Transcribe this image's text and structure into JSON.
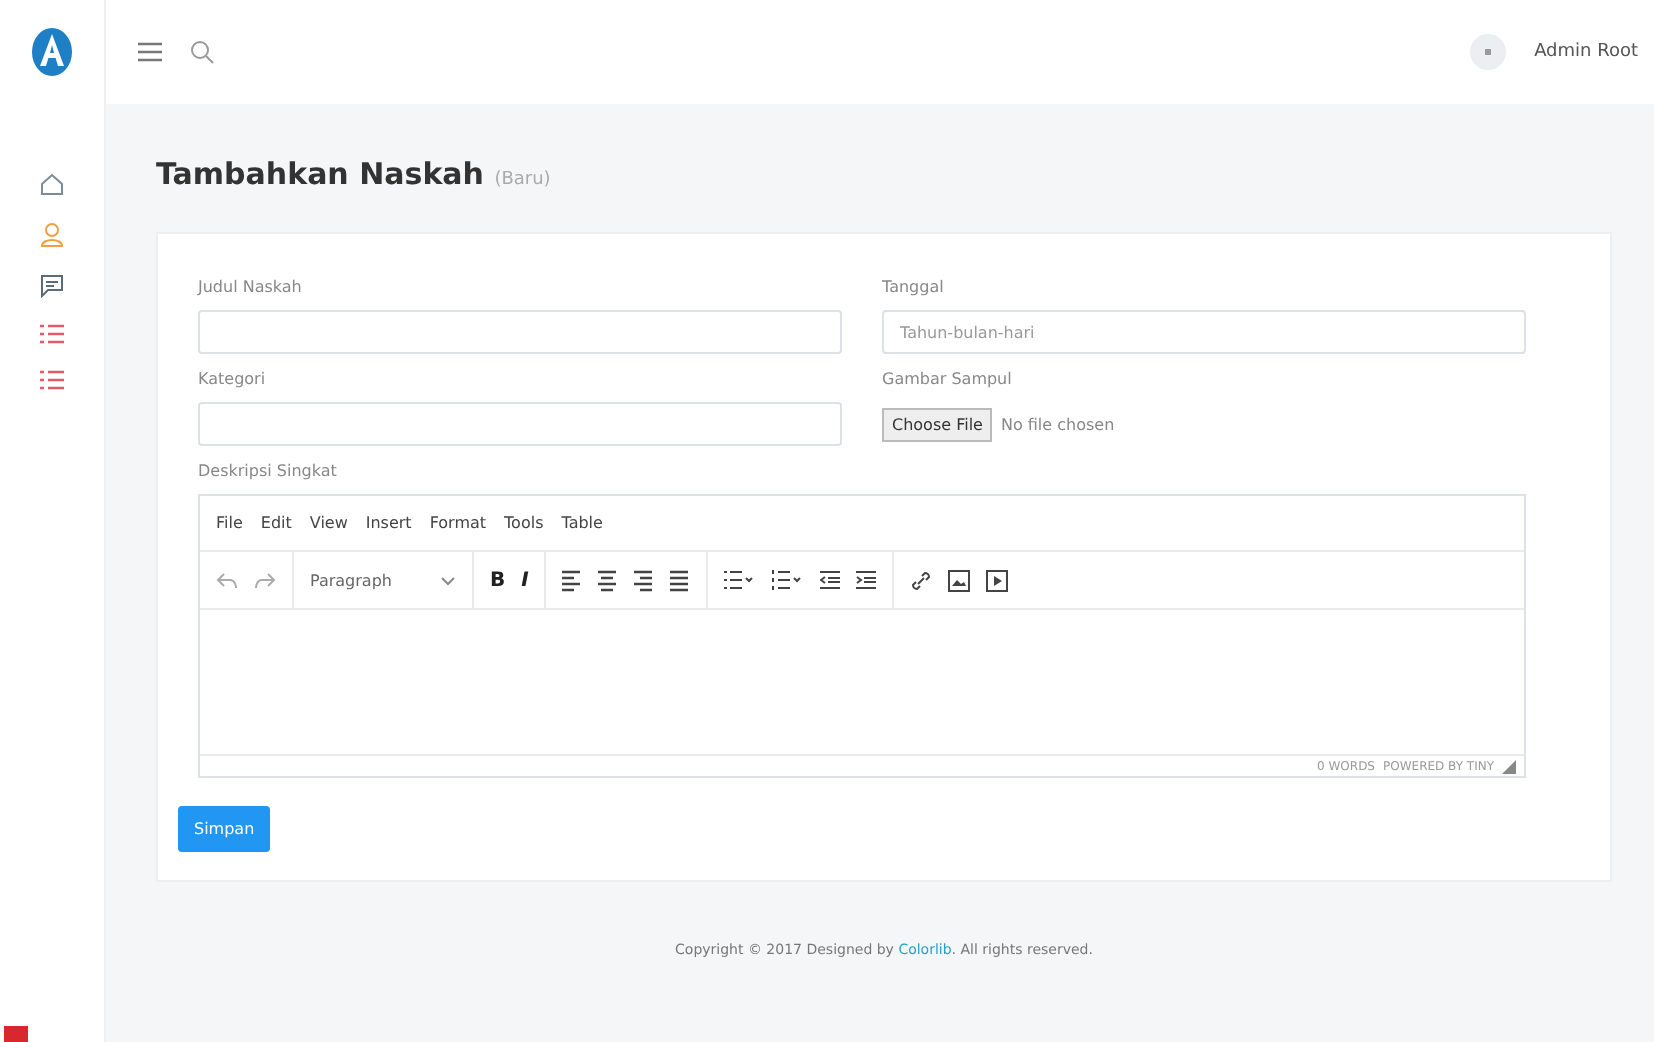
{
  "topbar": {
    "user": "Admin Root"
  },
  "page": {
    "title": "Tambahkan Naskah",
    "subtitle": "(Baru)"
  },
  "form": {
    "fields": [
      {
        "label": "Judul Naskah",
        "kind": "text"
      },
      {
        "label": "Tanggal",
        "kind": "text",
        "placeholder": "Tahun-bulan-hari"
      },
      {
        "label": "Kategori",
        "kind": "text"
      },
      {
        "label": "Gambar Sampul",
        "kind": "file",
        "button": "Choose File",
        "status": "No file chosen"
      }
    ],
    "editor": {
      "label": "Deskripsi Singkat",
      "menu": [
        "File",
        "Edit",
        "View",
        "Insert",
        "Format",
        "Tools",
        "Table"
      ],
      "block_format": "Paragraph",
      "bold": "B",
      "italic": "I",
      "word_count": "0 WORDS",
      "branding": "POWERED BY TINY"
    },
    "submit": "Simpan"
  },
  "footer": {
    "before": "Copyright © 2017 Designed by",
    "link": "Colorlib",
    "after": ". All rights reserved."
  }
}
